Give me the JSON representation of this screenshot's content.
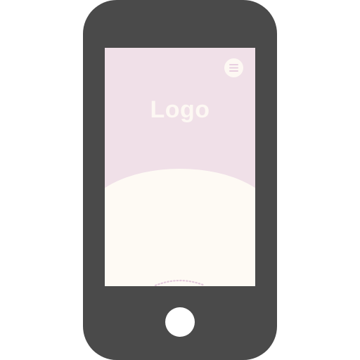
{
  "device": {
    "type": "smartphone",
    "body_color": "#4a4a4a",
    "home_button_icon": "home-button-icon"
  },
  "screen": {
    "background_color": "#f0e0e8",
    "logo": {
      "text": "Logo",
      "color": "#fdf8f3"
    },
    "menu_button": {
      "icon": "hamburger-menu-icon",
      "background_color": "#fdf8f3",
      "icon_color": "#e8cfe0"
    },
    "content_area": {
      "background_color": "#fefaf4"
    },
    "scroll_indicator": {
      "icon": "dotted-arc-indicator",
      "color": "#e3c9dc"
    }
  }
}
